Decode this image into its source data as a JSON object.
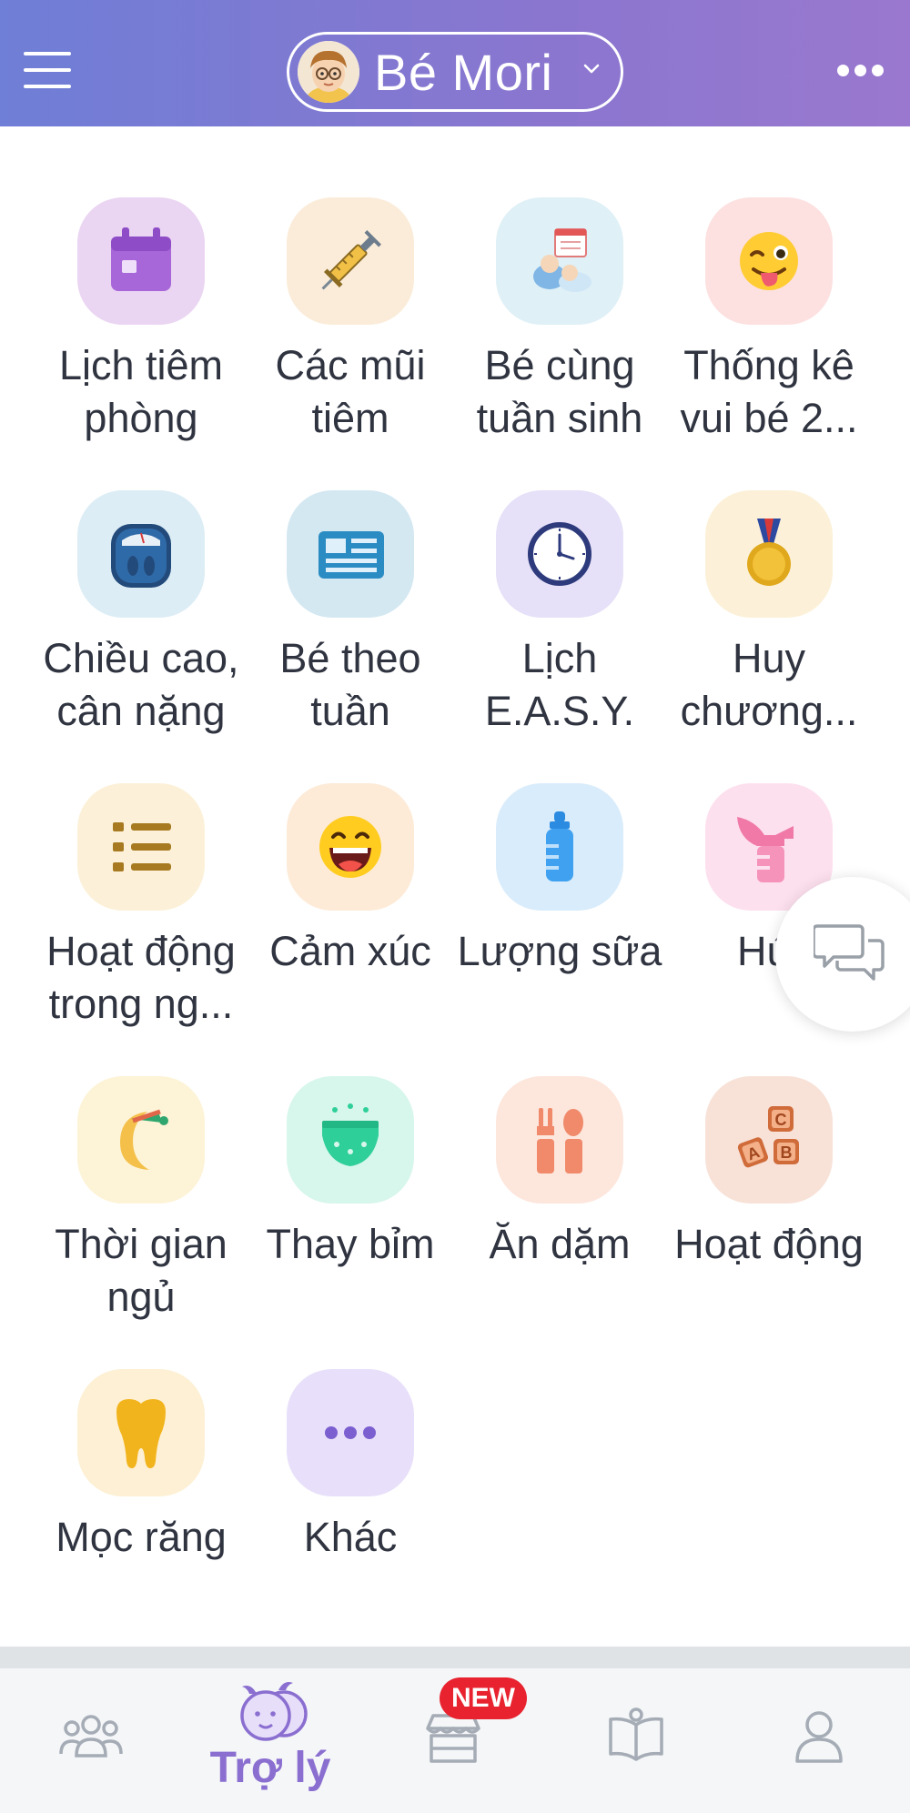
{
  "header": {
    "profile_name": "Bé Mori",
    "accent_gradient": [
      "#6f7ed6",
      "#9a78cf"
    ]
  },
  "tools": [
    {
      "label": "Lịch tiêm\nphòng",
      "icon": "calendar-icon",
      "bg": "#ead5f2"
    },
    {
      "label": "Các mũi\ntiêm",
      "icon": "syringe-icon",
      "bg": "#fbecd9"
    },
    {
      "label": "Bé cùng\ntuần sinh",
      "icon": "babies-icon",
      "bg": "#dff0f6"
    },
    {
      "label": "Thống kê\nvui bé 2...",
      "icon": "winking-face-icon",
      "bg": "#fde0e0"
    },
    {
      "label": "Chiều cao,\ncân nặng",
      "icon": "scale-icon",
      "bg": "#dcedf5"
    },
    {
      "label": "Bé theo\ntuần",
      "icon": "newspaper-icon",
      "bg": "#d4e8f2"
    },
    {
      "label": "Lịch\nE.A.S.Y.",
      "icon": "clock-icon",
      "bg": "#e6e0f8"
    },
    {
      "label": "Huy\nchương...",
      "icon": "medal-icon",
      "bg": "#fcf1d8"
    },
    {
      "label": "Hoạt động\ntrong ng...",
      "icon": "list-icon",
      "bg": "#fcf1d8"
    },
    {
      "label": "Cảm xúc",
      "icon": "laughing-face-icon",
      "bg": "#fdebd8"
    },
    {
      "label": "Lượng sữa",
      "icon": "bottle-icon",
      "bg": "#d9ecfb"
    },
    {
      "label": "Hút",
      "icon": "breast-pump-icon",
      "bg": "#fde0ee"
    },
    {
      "label": "Thời gian\nngủ",
      "icon": "moon-icon",
      "bg": "#fdf3d6"
    },
    {
      "label": "Thay bỉm",
      "icon": "diaper-icon",
      "bg": "#d7f6ec"
    },
    {
      "label": "Ăn dặm",
      "icon": "fork-spoon-icon",
      "bg": "#fde6dc"
    },
    {
      "label": "Hoạt động",
      "icon": "abc-blocks-icon",
      "bg": "#f8e2d8"
    },
    {
      "label": "Mọc răng",
      "icon": "tooth-icon",
      "bg": "#fdf0d4"
    },
    {
      "label": "Khác",
      "icon": "more-dots-icon",
      "bg": "#e8e0fa"
    }
  ],
  "tabbar": {
    "active_label": "Trợ lý",
    "new_badge": "NEW",
    "active_color": "#8a6ed0",
    "inactive_color": "#a5acb5"
  }
}
